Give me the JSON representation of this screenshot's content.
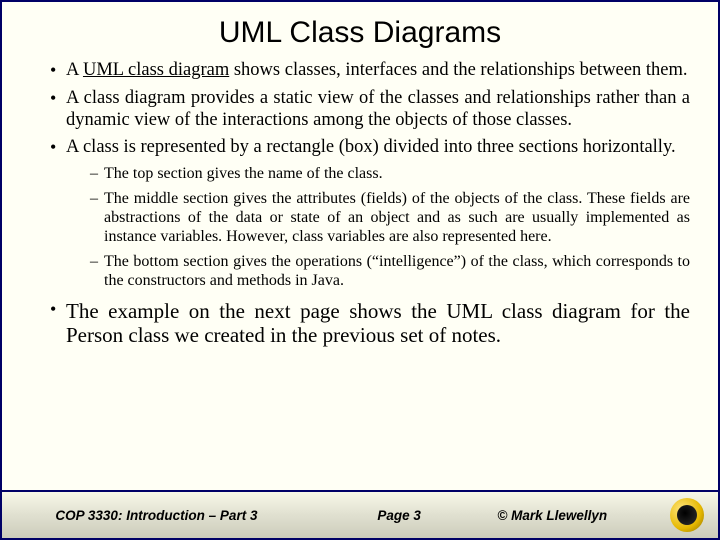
{
  "title": "UML Class Diagrams",
  "bullets": {
    "b1_pre": "A ",
    "b1_underline": "UML class diagram",
    "b1_post": " shows classes, interfaces and the relationships between them.",
    "b2": "A class diagram provides a static view of the classes and relationships rather than a dynamic view of the interactions among the objects of those classes.",
    "b3": "A class is represented by a rectangle (box) divided into three sections horizontally.",
    "sub1": "The top section gives the name of the class.",
    "sub2": "The middle section gives the attributes (fields) of the objects of the class. These fields are abstractions of the data or state of an object and as such are usually implemented as instance variables.  However, class variables are also represented here.",
    "sub3": "The bottom section gives the operations (“intelligence”) of the class, which corresponds to the constructors and methods in Java.",
    "b4": "The example on the next page shows the UML class diagram for the Person class we created in the previous set of notes."
  },
  "footer": {
    "course": "COP 3330: Introduction – Part 3",
    "page": "Page 3",
    "copyright": "© Mark Llewellyn"
  }
}
